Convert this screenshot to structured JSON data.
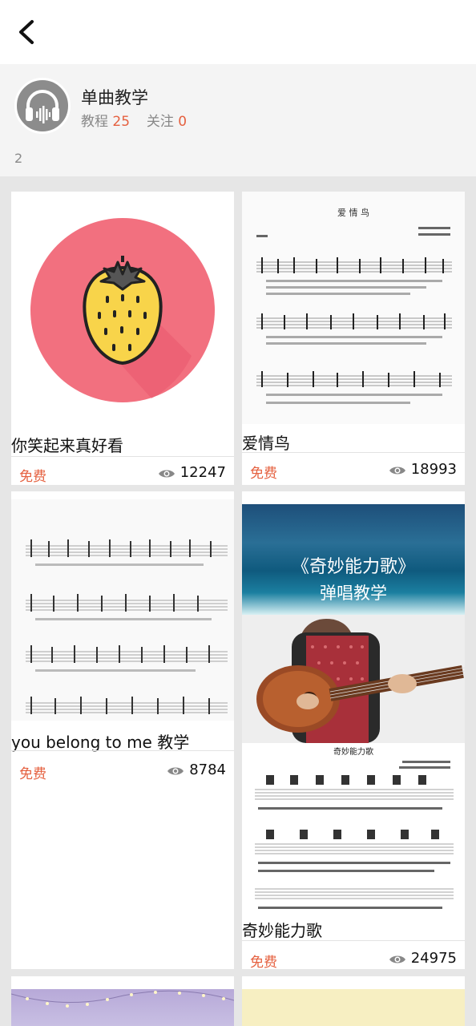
{
  "header": {
    "back_icon": "chevron-left-icon"
  },
  "profile": {
    "avatar_icon": "headphones-icon",
    "title": "单曲教学",
    "tutorials_label": "教程",
    "tutorials_count": "25",
    "follow_label": "关注",
    "follow_count": "0",
    "count_line": "2"
  },
  "colors": {
    "accent": "#e5603f",
    "strawberry_bg": "#f2707f",
    "strawberry_fill": "#f8d44a"
  },
  "cards": [
    {
      "title": "你笑起来真好看",
      "tag": "免费",
      "views": "12247",
      "thumb_icon": "strawberry-icon"
    },
    {
      "title": "爱情鸟",
      "tag": "免费",
      "views": "18993",
      "thumb_heading": "爱 情 鸟"
    },
    {
      "title": "you belong to me 教学",
      "tag": "免费",
      "views": "8784"
    },
    {
      "title": "奇妙能力歌",
      "tag": "免费",
      "views": "24975",
      "thumb_banner_line1": "《奇妙能力歌》",
      "thumb_banner_line2": "弹唱教学",
      "thumb_sheet_heading": "奇妙能力歌"
    }
  ]
}
